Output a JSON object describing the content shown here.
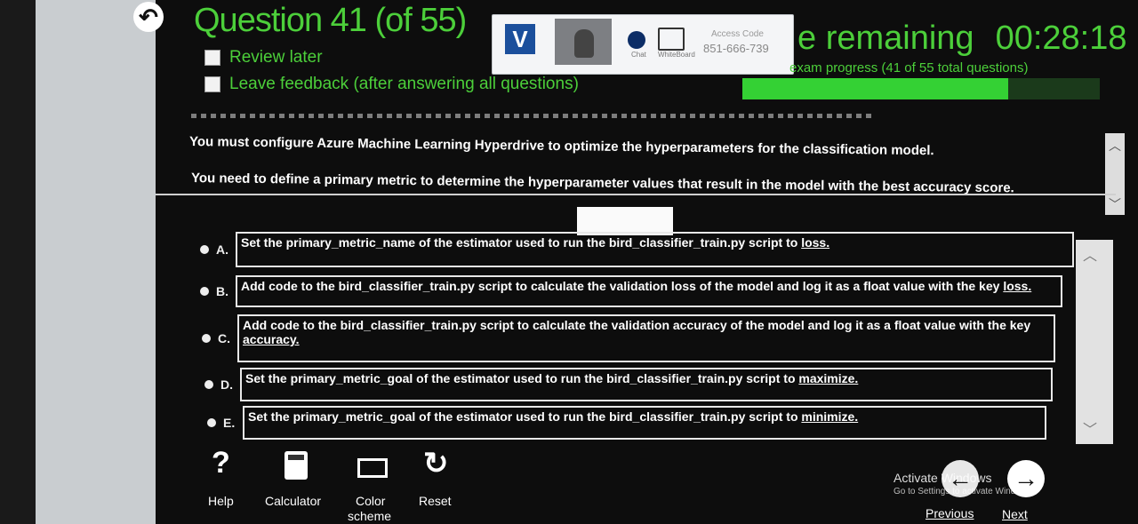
{
  "header": {
    "question_title": "Question 41 (of 55)",
    "review_later": "Review later",
    "leave_feedback": "Leave feedback (after answering all questions)",
    "time_remaining_label": "e remaining",
    "time_remaining_value": "00:28:18",
    "progress_text": "exam progress (41 of 55 total questions)",
    "progress_fraction": 0.745
  },
  "overlay": {
    "logo_glyph": "V",
    "chat_label": "Chat",
    "whiteboard_label": "WhiteBoard",
    "access_code_label": "Access Code",
    "access_code_value": "851-666-739"
  },
  "body": {
    "para1": "You must configure Azure Machine Learning Hyperdrive to optimize the hyperparameters for the classification model.",
    "para2": "You need to define a primary metric to determine the hyperparameter values that result in the model with the best accuracy score."
  },
  "options": [
    {
      "letter": "A.",
      "text": "Set the primary_metric_name of the estimator used to run the bird_classifier_train.py script to ",
      "emph": "loss."
    },
    {
      "letter": "B.",
      "text": "Add code to the bird_classifier_train.py script to calculate the validation loss of the model and log it as a float value with the key ",
      "emph": "loss."
    },
    {
      "letter": "C.",
      "text": "Add code to the bird_classifier_train.py script to calculate the validation accuracy of the model and log it as a float value with the key ",
      "emph": "accuracy."
    },
    {
      "letter": "D.",
      "text": "Set the primary_metric_goal of the estimator used to run the bird_classifier_train.py script to ",
      "emph": "maximize."
    },
    {
      "letter": "E.",
      "text": "Set the primary_metric_goal of the estimator used to run the bird_classifier_train.py script to ",
      "emph": "minimize."
    }
  ],
  "toolbar": {
    "help": "Help",
    "calculator": "Calculator",
    "color_scheme_1": "Color",
    "color_scheme_2": "scheme",
    "reset": "Reset"
  },
  "nav": {
    "previous": "Previous",
    "next": "Next"
  },
  "watermark": {
    "title": "Activate Windows",
    "subtitle": "Go to Settings to activate Windows."
  }
}
